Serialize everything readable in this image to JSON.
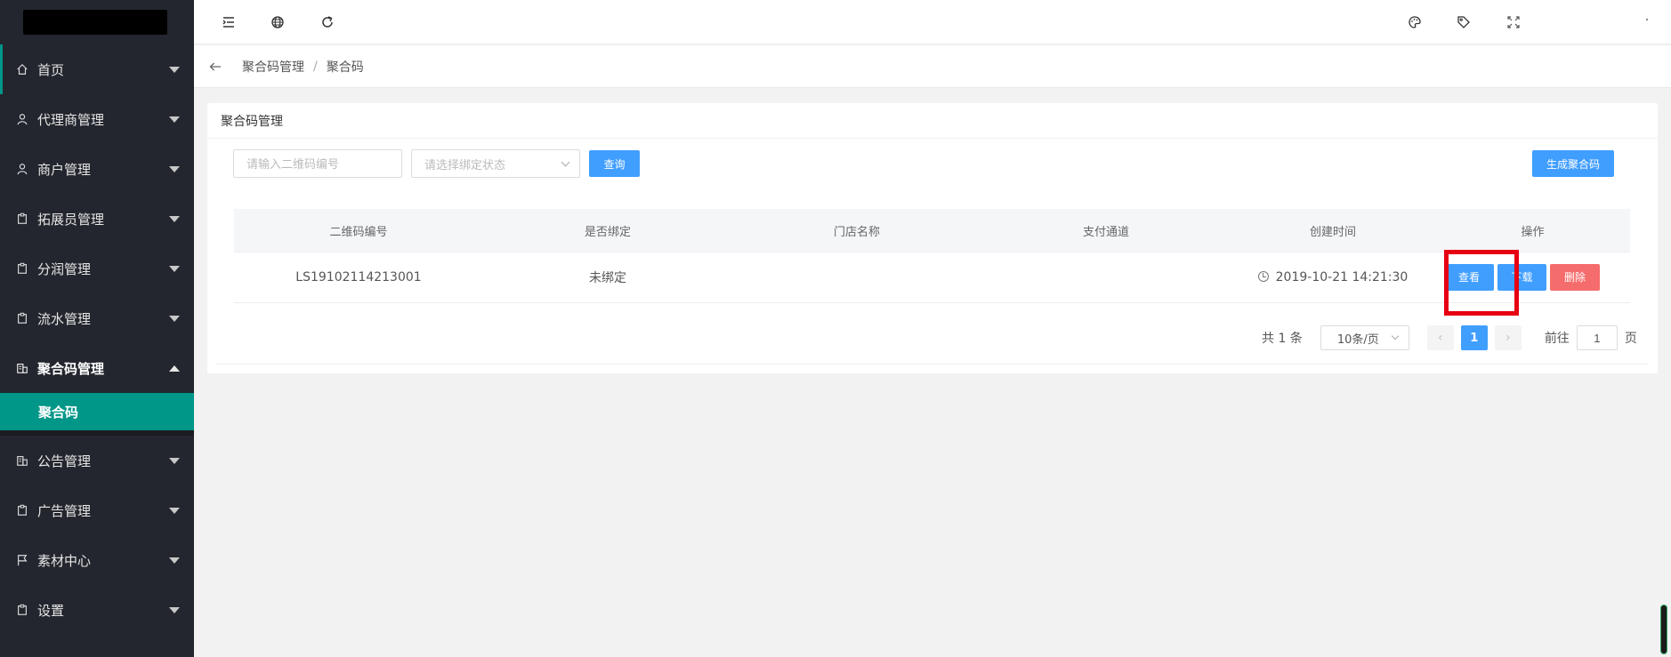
{
  "sidebar": {
    "items": [
      {
        "label": "首页",
        "icon": "home-icon"
      },
      {
        "label": "代理商管理",
        "icon": "user-icon"
      },
      {
        "label": "商户管理",
        "icon": "user-icon"
      },
      {
        "label": "拓展员管理",
        "icon": "clipboard-icon"
      },
      {
        "label": "分润管理",
        "icon": "clipboard-icon"
      },
      {
        "label": "流水管理",
        "icon": "clipboard-icon"
      },
      {
        "label": "聚合码管理",
        "icon": "building-icon"
      },
      {
        "label": "公告管理",
        "icon": "building-icon"
      },
      {
        "label": "广告管理",
        "icon": "clipboard-icon"
      },
      {
        "label": "素材中心",
        "icon": "flag-icon"
      },
      {
        "label": "设置",
        "icon": "clipboard-icon"
      }
    ],
    "sub_item": "聚合码",
    "accent_color": "#009688"
  },
  "header": {
    "icons": [
      "menu-fold-icon",
      "globe-icon",
      "refresh-icon",
      "palette-icon",
      "tag-icon",
      "fullscreen-icon"
    ]
  },
  "breadcrumb": {
    "parent": "聚合码管理",
    "separator": "/",
    "current": "聚合码"
  },
  "card": {
    "title": "聚合码管理",
    "search_placeholder": "请输入二维码编号",
    "status_placeholder": "请选择绑定状态",
    "query_button": "查询",
    "generate_button": "生成聚合码"
  },
  "table": {
    "columns": [
      "二维码编号",
      "是否绑定",
      "门店名称",
      "支付通道",
      "创建时间",
      "操作"
    ],
    "rows": [
      {
        "code": "LS19102114213001",
        "bound": "未绑定",
        "store": "",
        "channel": "",
        "created": "2019-10-21 14:21:30",
        "actions": {
          "view": "查看",
          "download": "下载",
          "delete": "删除"
        }
      }
    ]
  },
  "pagination": {
    "total": "共 1 条",
    "page_size": "10条/页",
    "current_page": "1",
    "goto_label": "前往",
    "goto_value": "1",
    "page_unit": "页"
  },
  "colors": {
    "primary": "#409eff",
    "danger": "#f56c6c",
    "highlight": "#e60012"
  }
}
